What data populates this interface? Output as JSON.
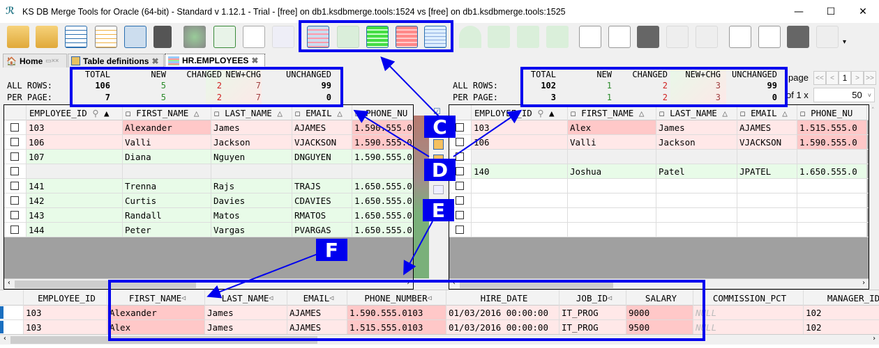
{
  "window": {
    "title": "KS DB Merge Tools for Oracle (64-bit) - Standard v 1.12.1 - Trial - [free] on db1.ksdbmerge.tools:1524 vs [free] on db1.ksdbmerge.tools:1525",
    "minimize": "—",
    "maximize": "☐",
    "close": "✕"
  },
  "tabs": [
    {
      "label": "Home"
    },
    {
      "label": "Table definitions"
    },
    {
      "label": "HR.EMPLOYEES"
    }
  ],
  "stats_headers": [
    "TOTAL",
    "NEW",
    "CHANGED",
    "NEW+CHG",
    "UNCHANGED"
  ],
  "stats_row_labels": [
    "ALL ROWS:",
    "PER PAGE:"
  ],
  "left_stats": {
    "all": [
      "106",
      "5",
      "2",
      "7",
      "99"
    ],
    "page": [
      "7",
      "5",
      "2",
      "7",
      "0"
    ]
  },
  "right_stats": {
    "all": [
      "102",
      "1",
      "2",
      "3",
      "99"
    ],
    "page": [
      "3",
      "1",
      "2",
      "3",
      "0"
    ]
  },
  "colors": {
    "new": "#2a8a2a",
    "changed": "#d02020",
    "callout": "#0000ee"
  },
  "pager": {
    "page_label": "page",
    "of_label": "of 1 x",
    "page_value": "1",
    "per_page": "50",
    "first": "<<",
    "prev": "<",
    "next": ">",
    "last": ">>"
  },
  "grid_headers": [
    "EMPLOYEE_ID",
    "FIRST_NAME",
    "LAST_NAME",
    "EMAIL",
    "PHONE_NU"
  ],
  "left_rows": [
    {
      "id": "103",
      "first": "Alexander",
      "last": "James",
      "email": "AJAMES",
      "phone": "1.590.555.0"
    },
    {
      "id": "106",
      "first": "Valli",
      "last": "Jackson",
      "email": "VJACKSON",
      "phone": "1.590.555.0"
    },
    {
      "id": "107",
      "first": "Diana",
      "last": "Nguyen",
      "email": "DNGUYEN",
      "phone": "1.590.555.0"
    },
    {
      "id": "",
      "first": "",
      "last": "",
      "email": "",
      "phone": ""
    },
    {
      "id": "141",
      "first": "Trenna",
      "last": "Rajs",
      "email": "TRAJS",
      "phone": "1.650.555.0"
    },
    {
      "id": "142",
      "first": "Curtis",
      "last": "Davies",
      "email": "CDAVIES",
      "phone": "1.650.555.0"
    },
    {
      "id": "143",
      "first": "Randall",
      "last": "Matos",
      "email": "RMATOS",
      "phone": "1.650.555.0"
    },
    {
      "id": "144",
      "first": "Peter",
      "last": "Vargas",
      "email": "PVARGAS",
      "phone": "1.650.555.0"
    }
  ],
  "right_rows": [
    {
      "id": "103",
      "first": "Alex",
      "last": "James",
      "email": "AJAMES",
      "phone": "1.515.555.0"
    },
    {
      "id": "106",
      "first": "Valli",
      "last": "Jackson",
      "email": "VJACKSON",
      "phone": "1.590.555.0"
    },
    {
      "id": "",
      "first": "",
      "last": "",
      "email": "",
      "phone": ""
    },
    {
      "id": "140",
      "first": "Joshua",
      "last": "Patel",
      "email": "JPATEL",
      "phone": "1.650.555.0"
    },
    {
      "id": "",
      "first": "",
      "last": "",
      "email": "",
      "phone": ""
    },
    {
      "id": "",
      "first": "",
      "last": "",
      "email": "",
      "phone": ""
    },
    {
      "id": "",
      "first": "",
      "last": "",
      "email": "",
      "phone": ""
    },
    {
      "id": "",
      "first": "",
      "last": "",
      "email": "",
      "phone": ""
    }
  ],
  "bottom_headers": [
    "EMPLOYEE_ID",
    "FIRST_NAME",
    "LAST_NAME",
    "EMAIL",
    "PHONE_NUMBER",
    "HIRE_DATE",
    "JOB_ID",
    "SALARY",
    "COMMISSION_PCT",
    "MANAGER_ID"
  ],
  "bottom_rows": [
    [
      "103",
      "Alexander",
      "James",
      "AJAMES",
      "1.590.555.0103",
      "01/03/2016 00:00:00",
      "IT_PROG",
      "9000",
      "NULL",
      "102"
    ],
    [
      "103",
      "Alex",
      "James",
      "AJAMES",
      "1.515.555.0103",
      "01/03/2016 00:00:00",
      "IT_PROG",
      "9500",
      "NULL",
      "102"
    ]
  ],
  "callouts": [
    "C",
    "D",
    "E",
    "F"
  ]
}
